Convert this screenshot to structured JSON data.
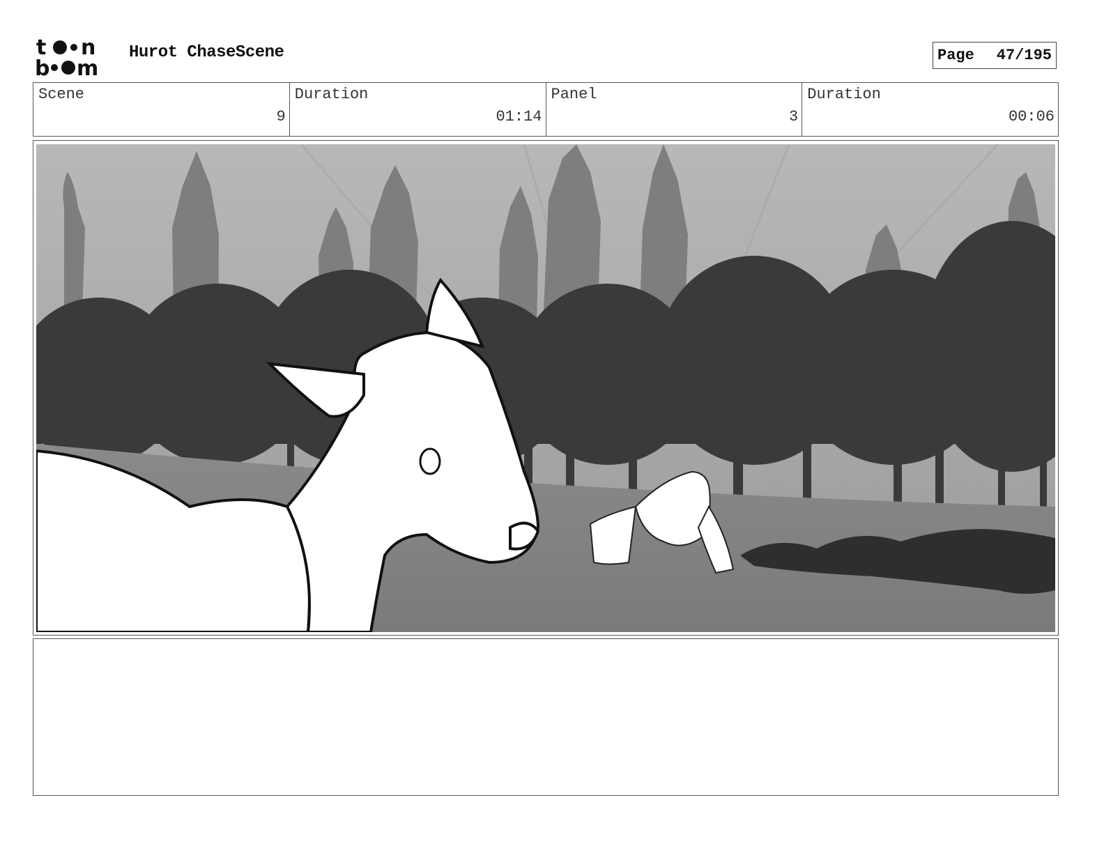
{
  "header": {
    "logo_text": "toon boom",
    "project_title": "Hurot ChaseScene",
    "page_label": "Page",
    "page_value": "47/195"
  },
  "info": {
    "scene_label": "Scene",
    "scene_value": "9",
    "scene_duration_label": "Duration",
    "scene_duration_value": "01:14",
    "panel_label": "Panel",
    "panel_value": "3",
    "panel_duration_label": "Duration",
    "panel_duration_value": "00:06"
  },
  "notes": {
    "text": ""
  }
}
